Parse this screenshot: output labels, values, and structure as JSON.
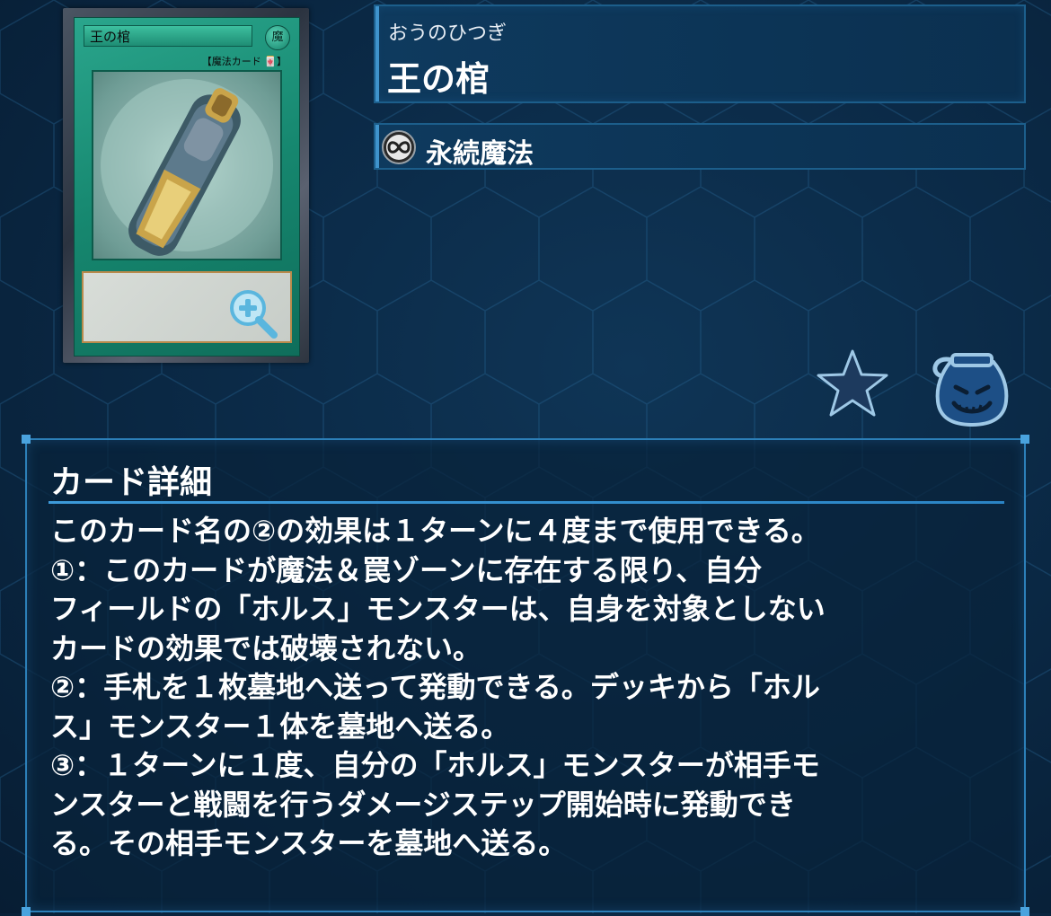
{
  "card": {
    "furigana": "おうのひつぎ",
    "name": "王の棺",
    "image": {
      "name_text": "王の棺",
      "attribute_text": "魔",
      "type_line": "【魔法カード 🀄】"
    },
    "zoom_icon": "zoom-in-icon"
  },
  "type_panel": {
    "icon": "infinity-icon",
    "label": "永続魔法"
  },
  "actions": {
    "favorite_icon": "star-icon",
    "collection_icon": "pot-of-greed-icon"
  },
  "details": {
    "heading": "カード詳細",
    "lines": [
      "このカード名の②の効果は１ターンに４度まで使用できる。",
      "①：このカードが魔法＆罠ゾーンに存在する限り、自分",
      "フィールドの「ホルス」モンスターは、自身を対象としない",
      "カードの効果では破壊されない。",
      "②：手札を１枚墓地へ送って発動できる。デッキから「ホル",
      "ス」モンスター１体を墓地へ送る。",
      "③：１ターンに１度、自分の「ホルス」モンスターが相手モ",
      "ンスターと戦闘を行うダメージステップ開始時に発動でき",
      "る。その相手モンスターを墓地へ送る。"
    ]
  },
  "colors": {
    "background": "#0b2a47",
    "panel_border": "#2c7fb8",
    "accent": "#3f93cc",
    "spell_card_green": "#16876f"
  }
}
